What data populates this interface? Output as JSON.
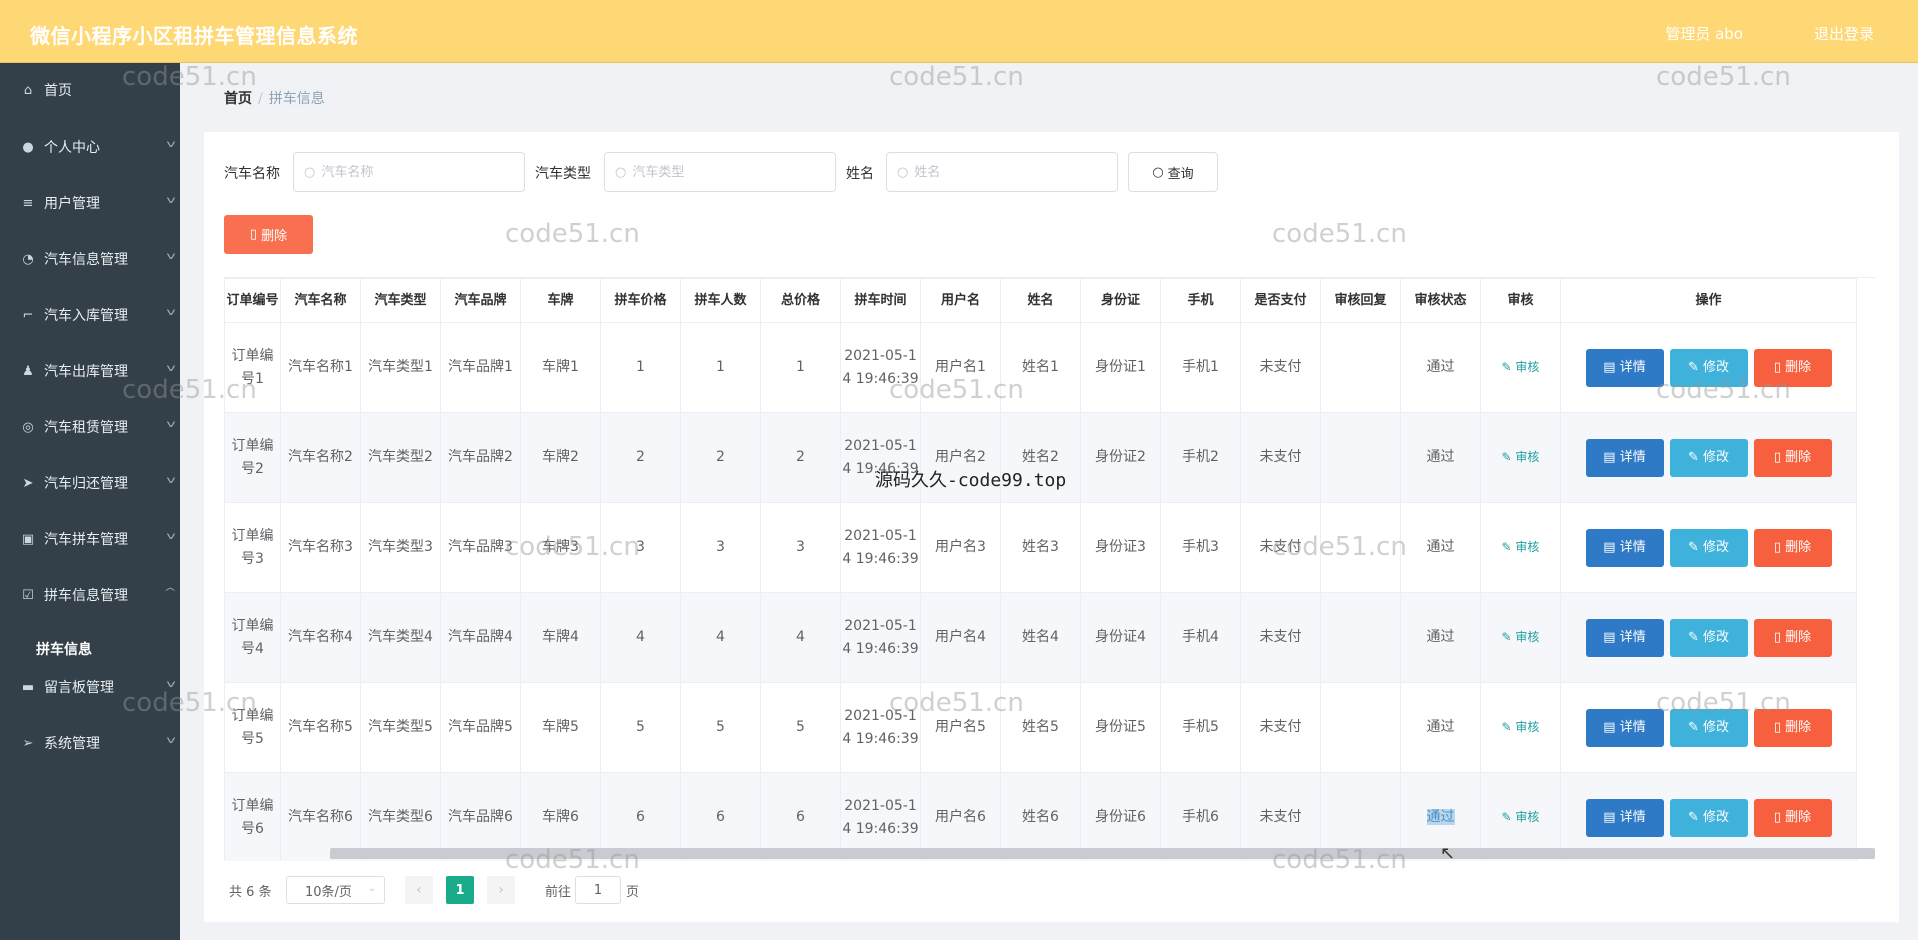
{
  "app": {
    "title": "微信小程序小区租拼车管理信息系统",
    "user": "管理员 abo",
    "logout": "退出登录"
  },
  "sidebar": {
    "items": [
      {
        "label": "首页",
        "icon": "home-icon",
        "glyph": "⌂"
      },
      {
        "label": "个人中心",
        "icon": "user-icon",
        "glyph": "●"
      },
      {
        "label": "用户管理",
        "icon": "list-icon",
        "glyph": "≡"
      },
      {
        "label": "汽车信息管理",
        "icon": "gauge-icon",
        "glyph": "◔"
      },
      {
        "label": "汽车入库管理",
        "icon": "crop-icon",
        "glyph": "⌐"
      },
      {
        "label": "汽车出库管理",
        "icon": "person-icon",
        "glyph": "♟"
      },
      {
        "label": "汽车租赁管理",
        "icon": "globe-icon",
        "glyph": "◎"
      },
      {
        "label": "汽车归还管理",
        "icon": "send-icon",
        "glyph": "➤"
      },
      {
        "label": "汽车拼车管理",
        "icon": "clipboard-icon",
        "glyph": "▣"
      },
      {
        "label": "拼车信息管理",
        "icon": "checkbox-icon",
        "glyph": "☑"
      },
      {
        "label": "留言板管理",
        "icon": "monitor-icon",
        "glyph": "▬"
      },
      {
        "label": "系统管理",
        "icon": "navigation-icon",
        "glyph": "➢"
      }
    ],
    "submenu": {
      "label": "拼车信息"
    }
  },
  "breadcrumb": {
    "home": "首页",
    "separator": "/",
    "current": "拼车信息"
  },
  "search": {
    "car_name": {
      "label": "汽车名称",
      "placeholder": "汽车名称",
      "value": ""
    },
    "car_type": {
      "label": "汽车类型",
      "placeholder": "汽车类型",
      "value": ""
    },
    "name": {
      "label": "姓名",
      "placeholder": "姓名",
      "value": ""
    },
    "query_label": "查询"
  },
  "toolbar": {
    "delete_label": "删除"
  },
  "table": {
    "columns": [
      "订单编号",
      "汽车名称",
      "汽车类型",
      "汽车品牌",
      "车牌",
      "拼车价格",
      "拼车人数",
      "总价格",
      "拼车时间",
      "用户名",
      "姓名",
      "身份证",
      "手机",
      "是否支付",
      "审核回复",
      "审核状态",
      "审核",
      "操作"
    ],
    "rows": [
      {
        "order": "订单编号1",
        "car_name": "汽车名称1",
        "car_type": "汽车类型1",
        "brand": "汽车品牌1",
        "plate": "车牌1",
        "price": "1",
        "count": "1",
        "total": "1",
        "time": "2021-05-14 19:46:39",
        "username": "用户名1",
        "name": "姓名1",
        "id_card": "身份证1",
        "phone": "手机1",
        "paid": "未支付",
        "reply": "",
        "status": "通过"
      },
      {
        "order": "订单编号2",
        "car_name": "汽车名称2",
        "car_type": "汽车类型2",
        "brand": "汽车品牌2",
        "plate": "车牌2",
        "price": "2",
        "count": "2",
        "total": "2",
        "time": "2021-05-14 19:46:39",
        "username": "用户名2",
        "name": "姓名2",
        "id_card": "身份证2",
        "phone": "手机2",
        "paid": "未支付",
        "reply": "",
        "status": "通过"
      },
      {
        "order": "订单编号3",
        "car_name": "汽车名称3",
        "car_type": "汽车类型3",
        "brand": "汽车品牌3",
        "plate": "车牌3",
        "price": "3",
        "count": "3",
        "total": "3",
        "time": "2021-05-14 19:46:39",
        "username": "用户名3",
        "name": "姓名3",
        "id_card": "身份证3",
        "phone": "手机3",
        "paid": "未支付",
        "reply": "",
        "status": "通过"
      },
      {
        "order": "订单编号4",
        "car_name": "汽车名称4",
        "car_type": "汽车类型4",
        "brand": "汽车品牌4",
        "plate": "车牌4",
        "price": "4",
        "count": "4",
        "total": "4",
        "time": "2021-05-14 19:46:39",
        "username": "用户名4",
        "name": "姓名4",
        "id_card": "身份证4",
        "phone": "手机4",
        "paid": "未支付",
        "reply": "",
        "status": "通过"
      },
      {
        "order": "订单编号5",
        "car_name": "汽车名称5",
        "car_type": "汽车类型5",
        "brand": "汽车品牌5",
        "plate": "车牌5",
        "price": "5",
        "count": "5",
        "total": "5",
        "time": "2021-05-14 19:46:39",
        "username": "用户名5",
        "name": "姓名5",
        "id_card": "身份证5",
        "phone": "手机5",
        "paid": "未支付",
        "reply": "",
        "status": "通过"
      },
      {
        "order": "订单编号6",
        "car_name": "汽车名称6",
        "car_type": "汽车类型6",
        "brand": "汽车品牌6",
        "plate": "车牌6",
        "price": "6",
        "count": "6",
        "total": "6",
        "time": "2021-05-14 19:46:39",
        "username": "用户名6",
        "name": "姓名6",
        "id_card": "身份证6",
        "phone": "手机6",
        "paid": "未支付",
        "reply": "",
        "status": "通过"
      }
    ],
    "audit_label": "审核",
    "detail_label": "详情",
    "edit_label": "修改",
    "delete_label": "删除"
  },
  "pagination": {
    "total": "共 6 条",
    "page_size": "10条/页",
    "current_page": "1",
    "goto_prefix": "前往",
    "goto_value": "1",
    "goto_suffix": "页"
  },
  "watermarks": {
    "site": "code51.cn",
    "center": "源码久久-code99.top"
  },
  "colors": {
    "header": "#ffd876",
    "sidebar": "#334049",
    "primary": "#2e7ac6",
    "info": "#3fb2dc",
    "danger": "#f6603e",
    "accent": "#1aab8a"
  }
}
